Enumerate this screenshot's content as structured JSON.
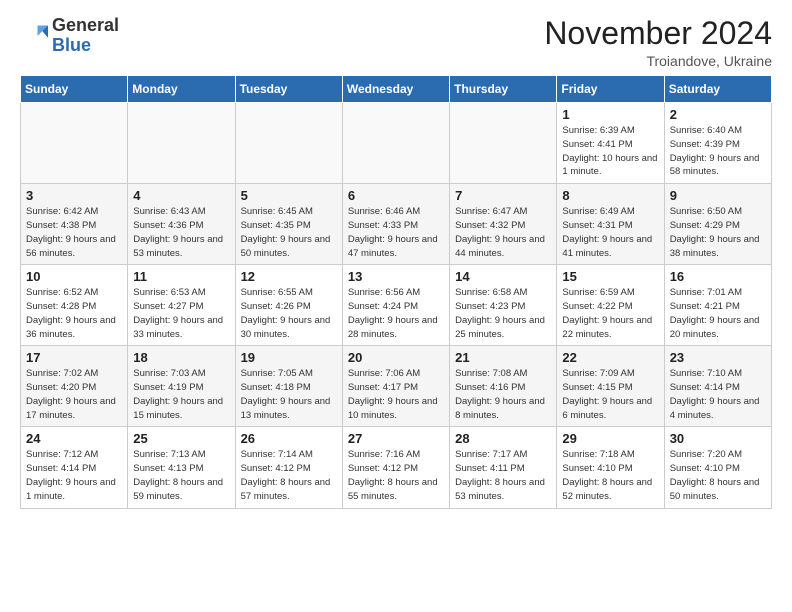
{
  "logo": {
    "general": "General",
    "blue": "Blue"
  },
  "title": "November 2024",
  "location": "Troiandove, Ukraine",
  "weekdays": [
    "Sunday",
    "Monday",
    "Tuesday",
    "Wednesday",
    "Thursday",
    "Friday",
    "Saturday"
  ],
  "weeks": [
    [
      {
        "day": "",
        "info": ""
      },
      {
        "day": "",
        "info": ""
      },
      {
        "day": "",
        "info": ""
      },
      {
        "day": "",
        "info": ""
      },
      {
        "day": "",
        "info": ""
      },
      {
        "day": "1",
        "info": "Sunrise: 6:39 AM\nSunset: 4:41 PM\nDaylight: 10 hours\nand 1 minute."
      },
      {
        "day": "2",
        "info": "Sunrise: 6:40 AM\nSunset: 4:39 PM\nDaylight: 9 hours\nand 58 minutes."
      }
    ],
    [
      {
        "day": "3",
        "info": "Sunrise: 6:42 AM\nSunset: 4:38 PM\nDaylight: 9 hours\nand 56 minutes."
      },
      {
        "day": "4",
        "info": "Sunrise: 6:43 AM\nSunset: 4:36 PM\nDaylight: 9 hours\nand 53 minutes."
      },
      {
        "day": "5",
        "info": "Sunrise: 6:45 AM\nSunset: 4:35 PM\nDaylight: 9 hours\nand 50 minutes."
      },
      {
        "day": "6",
        "info": "Sunrise: 6:46 AM\nSunset: 4:33 PM\nDaylight: 9 hours\nand 47 minutes."
      },
      {
        "day": "7",
        "info": "Sunrise: 6:47 AM\nSunset: 4:32 PM\nDaylight: 9 hours\nand 44 minutes."
      },
      {
        "day": "8",
        "info": "Sunrise: 6:49 AM\nSunset: 4:31 PM\nDaylight: 9 hours\nand 41 minutes."
      },
      {
        "day": "9",
        "info": "Sunrise: 6:50 AM\nSunset: 4:29 PM\nDaylight: 9 hours\nand 38 minutes."
      }
    ],
    [
      {
        "day": "10",
        "info": "Sunrise: 6:52 AM\nSunset: 4:28 PM\nDaylight: 9 hours\nand 36 minutes."
      },
      {
        "day": "11",
        "info": "Sunrise: 6:53 AM\nSunset: 4:27 PM\nDaylight: 9 hours\nand 33 minutes."
      },
      {
        "day": "12",
        "info": "Sunrise: 6:55 AM\nSunset: 4:26 PM\nDaylight: 9 hours\nand 30 minutes."
      },
      {
        "day": "13",
        "info": "Sunrise: 6:56 AM\nSunset: 4:24 PM\nDaylight: 9 hours\nand 28 minutes."
      },
      {
        "day": "14",
        "info": "Sunrise: 6:58 AM\nSunset: 4:23 PM\nDaylight: 9 hours\nand 25 minutes."
      },
      {
        "day": "15",
        "info": "Sunrise: 6:59 AM\nSunset: 4:22 PM\nDaylight: 9 hours\nand 22 minutes."
      },
      {
        "day": "16",
        "info": "Sunrise: 7:01 AM\nSunset: 4:21 PM\nDaylight: 9 hours\nand 20 minutes."
      }
    ],
    [
      {
        "day": "17",
        "info": "Sunrise: 7:02 AM\nSunset: 4:20 PM\nDaylight: 9 hours\nand 17 minutes."
      },
      {
        "day": "18",
        "info": "Sunrise: 7:03 AM\nSunset: 4:19 PM\nDaylight: 9 hours\nand 15 minutes."
      },
      {
        "day": "19",
        "info": "Sunrise: 7:05 AM\nSunset: 4:18 PM\nDaylight: 9 hours\nand 13 minutes."
      },
      {
        "day": "20",
        "info": "Sunrise: 7:06 AM\nSunset: 4:17 PM\nDaylight: 9 hours\nand 10 minutes."
      },
      {
        "day": "21",
        "info": "Sunrise: 7:08 AM\nSunset: 4:16 PM\nDaylight: 9 hours\nand 8 minutes."
      },
      {
        "day": "22",
        "info": "Sunrise: 7:09 AM\nSunset: 4:15 PM\nDaylight: 9 hours\nand 6 minutes."
      },
      {
        "day": "23",
        "info": "Sunrise: 7:10 AM\nSunset: 4:14 PM\nDaylight: 9 hours\nand 4 minutes."
      }
    ],
    [
      {
        "day": "24",
        "info": "Sunrise: 7:12 AM\nSunset: 4:14 PM\nDaylight: 9 hours\nand 1 minute."
      },
      {
        "day": "25",
        "info": "Sunrise: 7:13 AM\nSunset: 4:13 PM\nDaylight: 8 hours\nand 59 minutes."
      },
      {
        "day": "26",
        "info": "Sunrise: 7:14 AM\nSunset: 4:12 PM\nDaylight: 8 hours\nand 57 minutes."
      },
      {
        "day": "27",
        "info": "Sunrise: 7:16 AM\nSunset: 4:12 PM\nDaylight: 8 hours\nand 55 minutes."
      },
      {
        "day": "28",
        "info": "Sunrise: 7:17 AM\nSunset: 4:11 PM\nDaylight: 8 hours\nand 53 minutes."
      },
      {
        "day": "29",
        "info": "Sunrise: 7:18 AM\nSunset: 4:10 PM\nDaylight: 8 hours\nand 52 minutes."
      },
      {
        "day": "30",
        "info": "Sunrise: 7:20 AM\nSunset: 4:10 PM\nDaylight: 8 hours\nand 50 minutes."
      }
    ]
  ]
}
